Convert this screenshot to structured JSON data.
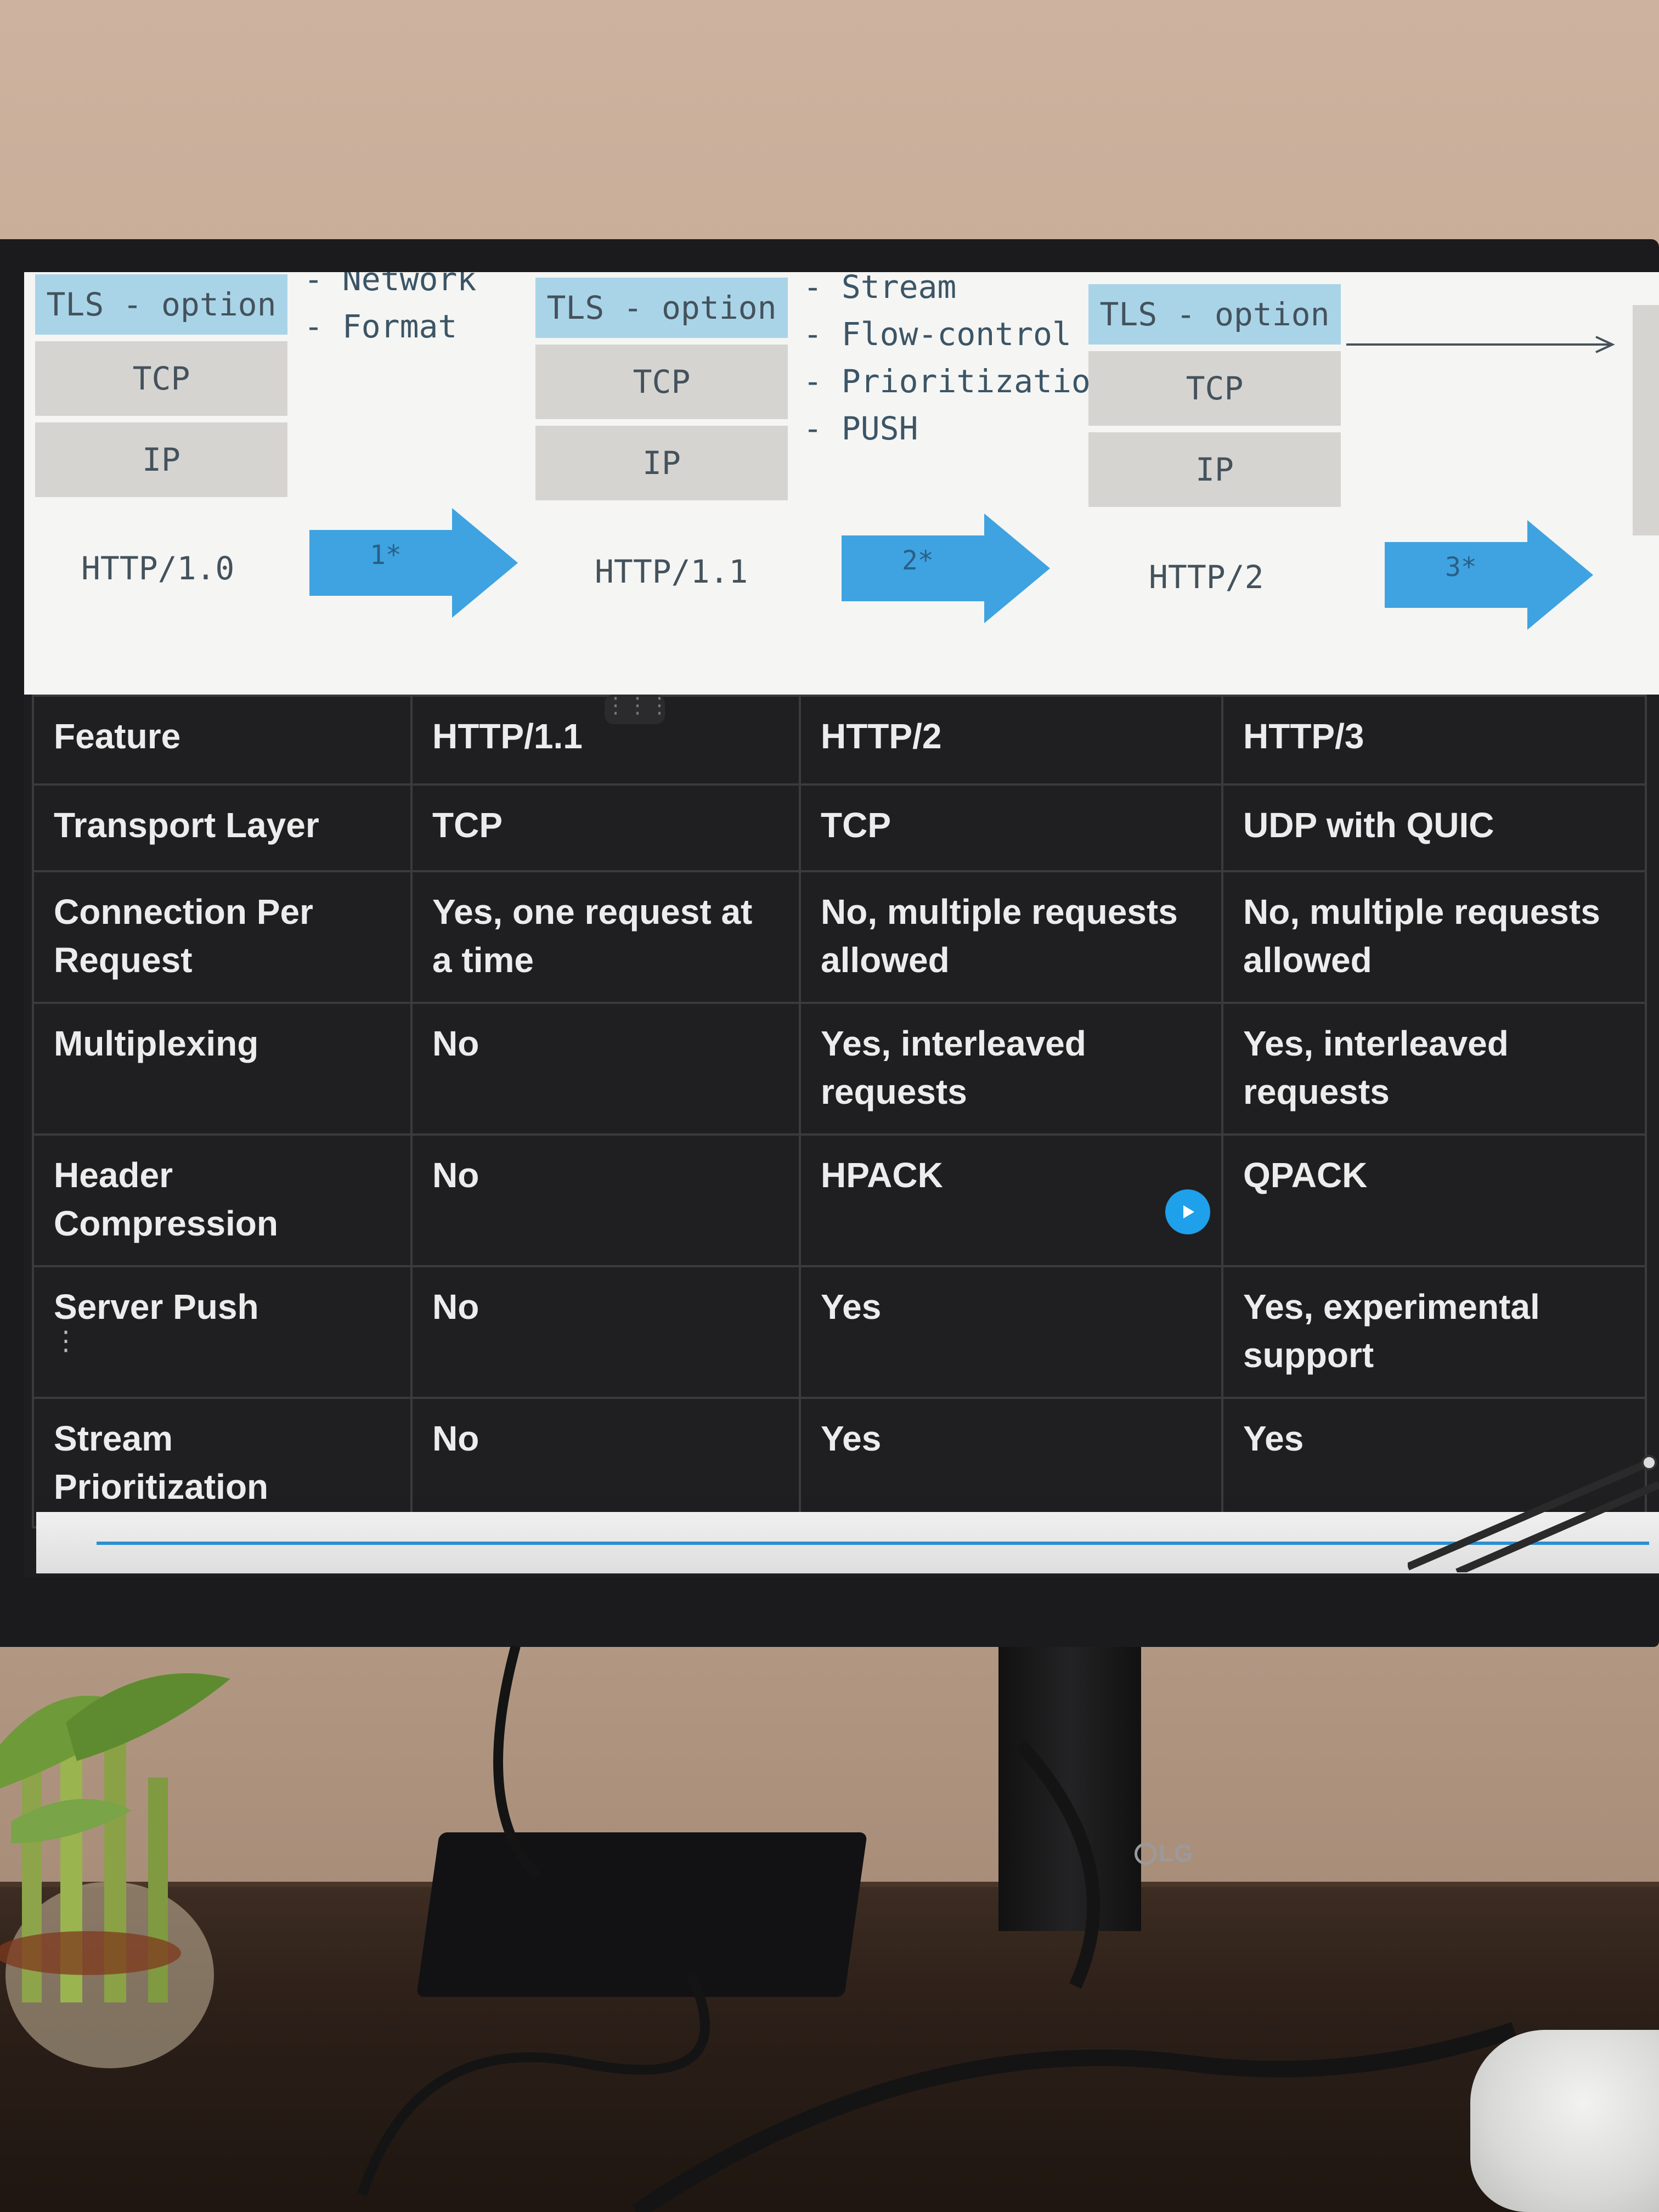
{
  "diagram": {
    "stacks": [
      {
        "layers": [
          "TLS - option",
          "TCP",
          "IP"
        ],
        "version": "HTTP/1.0"
      },
      {
        "layers": [
          "TLS - option",
          "TCP",
          "IP"
        ],
        "version": "HTTP/1.1"
      },
      {
        "layers": [
          "TLS - option",
          "TCP",
          "IP"
        ],
        "version": "HTTP/2"
      }
    ],
    "arrows": [
      "1*",
      "2*",
      "3*"
    ],
    "notes_1": "- Network\n- Format",
    "notes_2": "- Stream\n- Flow-control\n- Prioritization\n- PUSH"
  },
  "table": {
    "headers": [
      "Feature",
      "HTTP/1.1",
      "HTTP/2",
      "HTTP/3"
    ],
    "rows": [
      [
        "Transport Layer",
        "TCP",
        "TCP",
        "UDP with QUIC"
      ],
      [
        "Connection Per Request",
        "Yes, one request at a time",
        "No, multiple requests allowed",
        "No, multiple requests allowed"
      ],
      [
        "Multiplexing",
        "No",
        "Yes, interleaved requests",
        "Yes, interleaved requests"
      ],
      [
        "Header Compression",
        "No",
        "HPACK",
        "QPACK"
      ],
      [
        "Server Push",
        "No",
        "Yes",
        "Yes, experimental support"
      ],
      [
        "Stream Prioritization",
        "No",
        "Yes",
        "Yes"
      ]
    ]
  },
  "monitor": {
    "brand": "LG"
  },
  "colors": {
    "tls_layer": "#a9d4e8",
    "layer_gray": "#d6d4d1",
    "arrow": "#3ea3e0",
    "table_bg": "#1f1f21",
    "play_button": "#1ea0ea"
  },
  "icons": [
    "play-icon",
    "drag-handle-icon"
  ]
}
